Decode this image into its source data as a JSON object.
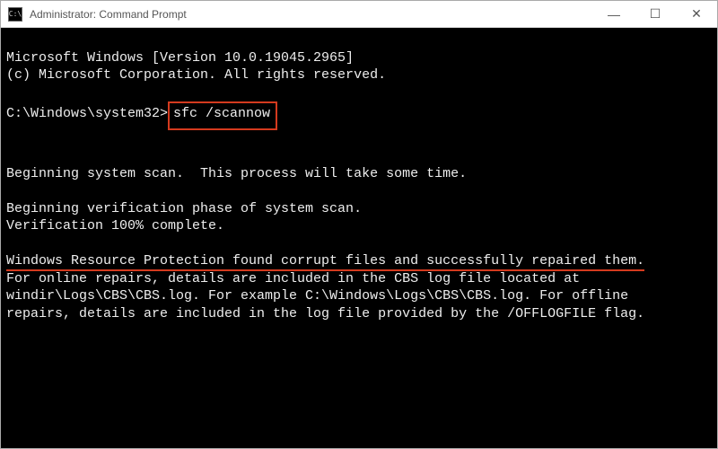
{
  "window": {
    "title": "Administrator: Command Prompt"
  },
  "terminal": {
    "line_version": "Microsoft Windows [Version 10.0.19045.2965]",
    "line_copyright": "(c) Microsoft Corporation. All rights reserved.",
    "prompt": "C:\\Windows\\system32>",
    "command": "sfc /scannow",
    "line_begin_scan": "Beginning system scan.  This process will take some time.",
    "line_begin_verify": "Beginning verification phase of system scan.",
    "line_verify_complete": "Verification 100% complete.",
    "line_result": "Windows Resource Protection found corrupt files and successfully repaired them.",
    "line_detail1": "For online repairs, details are included in the CBS log file located at",
    "line_detail2": "windir\\Logs\\CBS\\CBS.log. For example C:\\Windows\\Logs\\CBS\\CBS.log. For offline",
    "line_detail3": "repairs, details are included in the log file provided by the /OFFLOGFILE flag."
  },
  "icons": {
    "cmd": "C:\\",
    "minimize": "—",
    "maximize": "☐",
    "close": "✕"
  }
}
